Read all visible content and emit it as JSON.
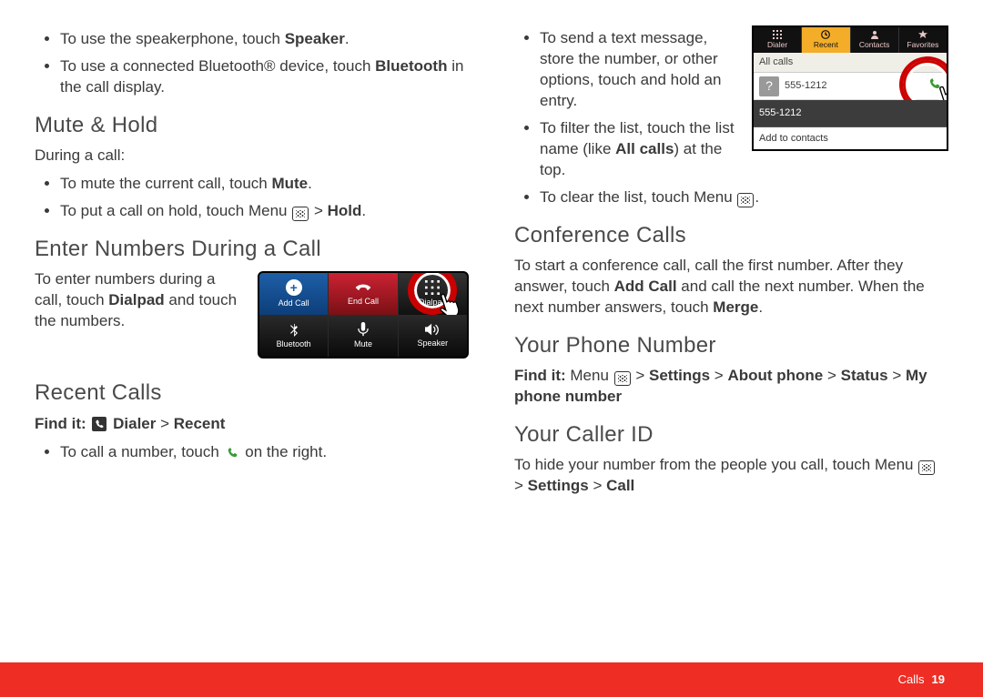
{
  "left": {
    "speaker_li_a": "To use the speakerphone, touch ",
    "speaker_li_b": "Speaker",
    "speaker_li_c": ".",
    "bt_li_a": "To use a connected Bluetooth® device, touch ",
    "bt_li_b": "Bluetooth",
    "bt_li_c": " in the call display.",
    "mute_hold_h": "Mute & Hold",
    "during": "During a call:",
    "mute_li_a": "To mute the current call, touch ",
    "mute_li_b": "Mute",
    "mute_li_c": ".",
    "hold_li_a": "To put a call on hold, touch Menu ",
    "hold_li_b": " > ",
    "hold_li_c": "Hold",
    "hold_li_d": ".",
    "enter_h": "Enter Numbers During a Call",
    "enter_p_a": "To enter numbers during a call, touch ",
    "enter_p_b": "Dialpad",
    "enter_p_c": " and touch the numbers.",
    "recent_h": "Recent Calls",
    "findit_label": "Find it: ",
    "findit_path_a": " Dialer",
    "findit_path_b": " > ",
    "findit_path_c": "Recent",
    "call_li_a": "To call a number, touch ",
    "call_li_b": " on the right.",
    "mini_call": {
      "add": "Add Call",
      "end": "End Call",
      "dial": "Dialpad",
      "bt": "Bluetooth",
      "mute": "Mute",
      "spk": "Speaker"
    }
  },
  "right": {
    "send_li": "To send a text message, store the number, or other options, touch and hold an entry.",
    "filter_li_a": "To filter the list, touch the list name (like ",
    "filter_li_b": "All calls",
    "filter_li_c": ") at the top.",
    "clear_li_a": "To clear the list, touch Menu ",
    "clear_li_b": ".",
    "conf_h": "Conference Calls",
    "conf_p_a": "To start a conference call, call the first number. After they answer, touch ",
    "conf_p_b": "Add Call",
    "conf_p_c": " and call the next number. When the next number answers, touch ",
    "conf_p_d": "Merge",
    "conf_p_e": ".",
    "ypn_h": "Your Phone Number",
    "ypn_find": "Find it: ",
    "ypn_a": "Menu ",
    "ypn_b": " > ",
    "ypn_c": "Settings",
    "ypn_d": " > ",
    "ypn_e": "About phone",
    "ypn_f": " > ",
    "ypn_g": "Status",
    "ypn_h2": " > ",
    "ypn_i": "My phone number",
    "cid_h": "Your Caller ID",
    "cid_a": "To hide your number from the people you call, touch Menu ",
    "cid_b": " > ",
    "cid_c": "Settings",
    "cid_d": " > ",
    "cid_e": "Call",
    "mini_recent": {
      "tab1": "Dialer",
      "tab2": "Recent",
      "tab3": "Contacts",
      "tab4": "Favorites",
      "filter": "All calls",
      "n1": "555-1212",
      "n2": "555-1212",
      "add": "Add to contacts"
    }
  },
  "footer": {
    "section": "Calls",
    "page": "19"
  }
}
